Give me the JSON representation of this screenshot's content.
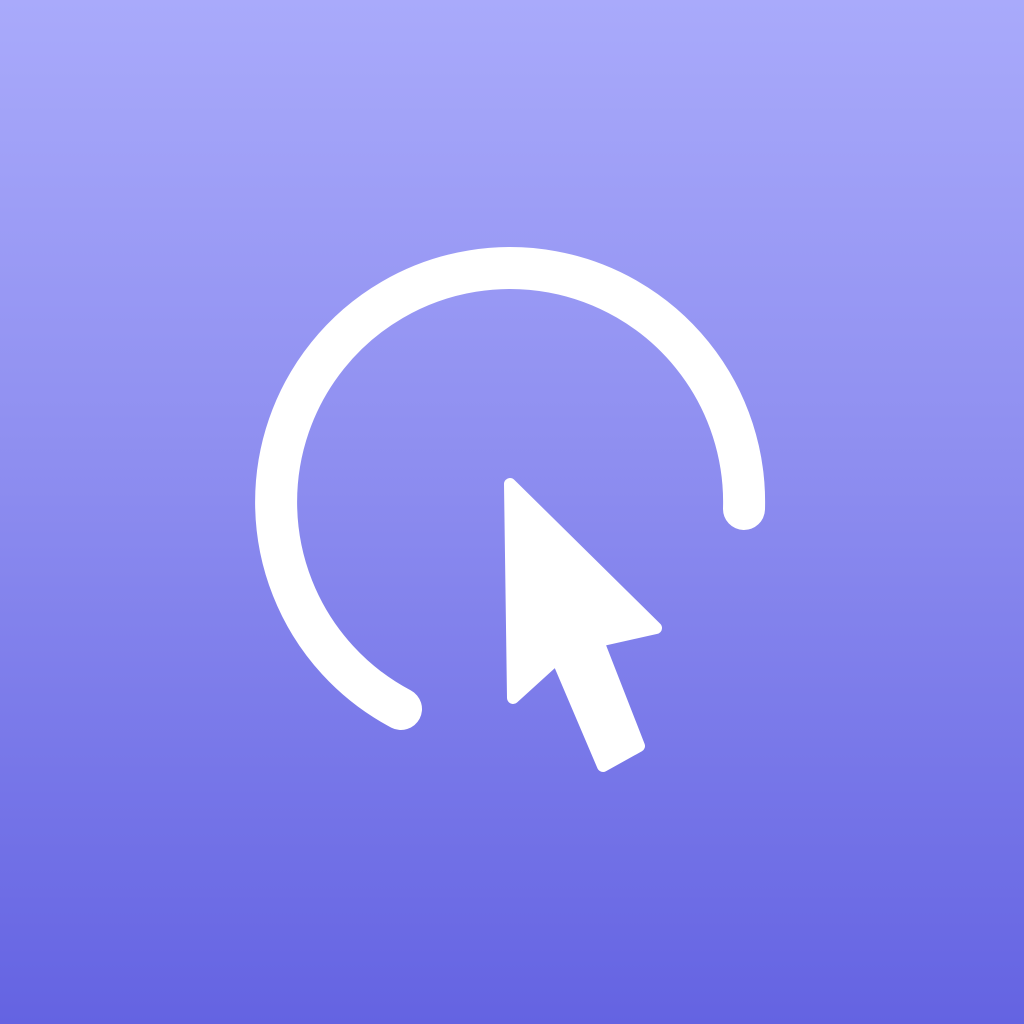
{
  "icon": {
    "name": "click-cursor-icon",
    "elements": [
      "open-ring",
      "arrow-cursor"
    ]
  },
  "colors": {
    "gradient_top": "#A9AAFB",
    "gradient_mid": "#8E8EF0",
    "gradient_bottom": "#6463E2",
    "glyph": "#FFFFFF"
  }
}
